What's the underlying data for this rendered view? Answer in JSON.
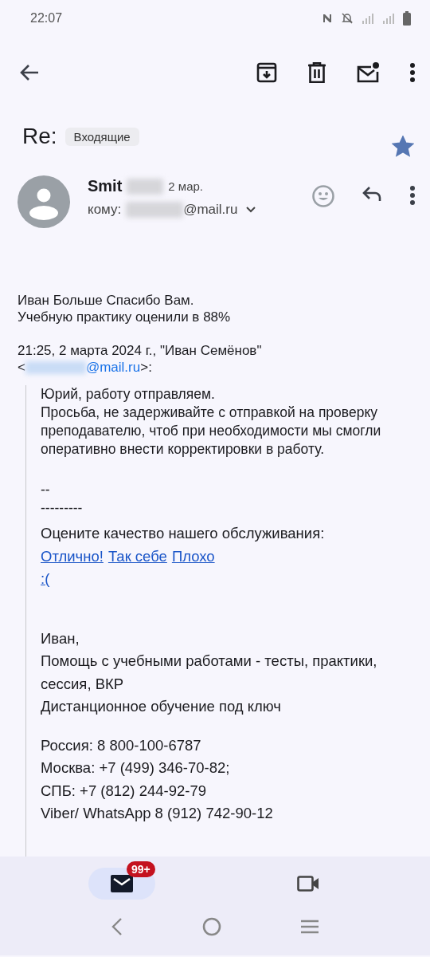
{
  "status_bar": {
    "time": "22:07"
  },
  "subject": {
    "title": "Re:",
    "label": "Входящие",
    "starred": true
  },
  "message": {
    "sender": "Smit",
    "date": "2 мар.",
    "to_label": "кому:",
    "to_address": "@mail.ru"
  },
  "body": {
    "intro": [
      "Иван Больше Спасибо Вам.",
      "Учебную практику оценили в 88%"
    ],
    "quote_header": {
      "line": "21:25, 2 марта 2024 г., \"Иван Семёнов\"",
      "prefix": "<",
      "link": "@mail.ru",
      "suffix": ">:"
    },
    "quote": {
      "paragraph": [
        "Юрий, работу отправляем.",
        "Просьба, не задерживайте с отправкой на проверку преподавателю, чтоб при необходимости мы смогли оперативно внести корректировки в работу."
      ],
      "separator": [
        "--",
        "---------"
      ],
      "rating_prompt": "Оцените качество нашего обслуживания:",
      "rating_links": [
        [
          "Отлично!",
          "Так себе",
          "Плохо"
        ],
        [
          ":("
        ]
      ],
      "signature": [
        "Иван,",
        "Помощь с учебными работами - тесты, практики, сессия, ВКР",
        "Дистанционное обучение под ключ"
      ],
      "phones": [
        "Россия: 8 800-100-6787",
        "Москва: +7 (499) 346-70-82;",
        "СПБ: +7 (812) 244-92-79",
        "Viber/ WhatsApp 8 (912) 742-90-12"
      ]
    }
  },
  "bottom_nav": [
    {
      "kind": "mail",
      "selected": true,
      "badge": "99+"
    },
    {
      "kind": "video",
      "selected": false
    }
  ]
}
